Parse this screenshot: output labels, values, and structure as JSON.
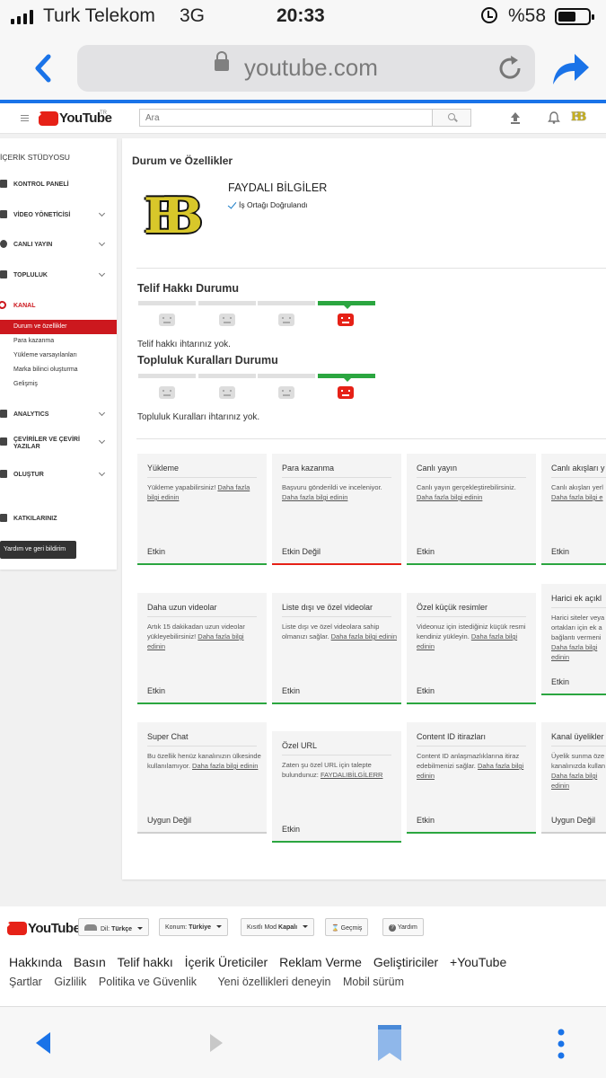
{
  "status_bar": {
    "carrier": "Turk Telekom",
    "network": "3G",
    "time": "20:33",
    "battery_percent": "%58",
    "battery_level": 0.58
  },
  "browser": {
    "url": "youtube.com"
  },
  "youtube_header": {
    "logo_text": "YouTube",
    "region_code": "TR",
    "search_placeholder": "Ara",
    "brand_color": "#e62117"
  },
  "sidebar": {
    "title": "İÇERİK STÜDYOSU",
    "items": [
      {
        "label": "KONTROL PANELİ",
        "icon": "dashboard-icon"
      },
      {
        "label": "VİDEO YÖNETİCİSİ",
        "icon": "video-manager-icon"
      },
      {
        "label": "CANLI YAYIN",
        "icon": "live-icon"
      },
      {
        "label": "TOPLULUK",
        "icon": "community-icon"
      },
      {
        "label": "KANAL",
        "icon": "channel-icon"
      },
      {
        "label": "ANALYTICS",
        "icon": "analytics-icon"
      },
      {
        "label": "ÇEVİRİLER VE ÇEVİRİ YAZILAR",
        "icon": "translate-icon"
      },
      {
        "label": "OLUŞTUR",
        "icon": "create-icon"
      },
      {
        "label": "KATKILARINIZ",
        "icon": "contributions-icon"
      }
    ],
    "kanal_sub": [
      "Durum ve özellikler",
      "Para kazanma",
      "Yükleme varsayılanları",
      "Marka bilinci oluşturma",
      "Gelişmiş"
    ],
    "help_button": "Yardım ve geri bildirim"
  },
  "main": {
    "title": "Durum ve Özellikler",
    "channel_name": "FAYDALI BİLGİLER",
    "partner_status": "İş Ortağı Doğrulandı",
    "copyright": {
      "title": "Telif Hakkı Durumu",
      "status": "Telif hakkı ihtarınız yok.",
      "active_segment": 4
    },
    "community": {
      "title": "Topluluk Kuralları Durumu",
      "status": "Topluluk Kuralları ihtarınız yok.",
      "active_segment": 4
    },
    "features": [
      {
        "title": "Yükleme",
        "desc": "Yükleme yapabilirsiniz!",
        "link": "Daha fazla bilgi edinin",
        "status": "Etkin",
        "state": "on"
      },
      {
        "title": "Para kazanma",
        "desc": "Başvuru gönderildi ve inceleniyor.",
        "link": "Daha fazla bilgi edinin",
        "status": "Etkin Değil",
        "state": "off"
      },
      {
        "title": "Canlı yayın",
        "desc": "Canlı yayın gerçekleştirebilirsiniz.",
        "link": "Daha fazla bilgi edinin",
        "status": "Etkin",
        "state": "on"
      },
      {
        "title": "Canlı akışları y",
        "desc": "Canlı akışları yerl",
        "link": "Daha fazla bilgi e",
        "status": "Etkin",
        "state": "on"
      },
      {
        "title": "Daha uzun videolar",
        "desc": "Artık 15 dakikadan uzun videolar yükleyebilirsiniz!",
        "link": "Daha fazla bilgi edinin",
        "status": "Etkin",
        "state": "on"
      },
      {
        "title": "Liste dışı ve özel videolar",
        "desc": "Liste dışı ve özel videolara sahip olmanızı sağlar.",
        "link": "Daha fazla bilgi edinin",
        "status": "Etkin",
        "state": "on"
      },
      {
        "title": "Özel küçük resimler",
        "desc": "Videonuz için istediğiniz küçük resmi kendiniz yükleyin.",
        "link": "Daha fazla bilgi edinin",
        "status": "Etkin",
        "state": "on"
      },
      {
        "title": "Harici ek açıkl",
        "desc": "Harici siteler veya ortakları için ek a bağlantı vermeni",
        "link": "Daha fazla bilgi edinin",
        "status": "Etkin",
        "state": "on"
      },
      {
        "title": "Super Chat",
        "desc": "Bu özellik henüz kanalınızın ülkesinde kullanılamıyor.",
        "link": "Daha fazla bilgi edinin",
        "status": "Uygun Değil",
        "state": "na"
      },
      {
        "title": "Özel URL",
        "desc": "Zaten şu özel URL için talepte bulundunuz:",
        "link": "FAYDALIBİLGİLERR",
        "status": "Etkin",
        "state": "on"
      },
      {
        "title": "Content ID itirazları",
        "desc": "Content ID anlaşmazlıklarına itiraz edebilmenizi sağlar.",
        "link": "Daha fazla bilgi edinin",
        "status": "Etkin",
        "state": "on"
      },
      {
        "title": "Kanal üyelikler",
        "desc": "Üyelik sunma öze kanalınızda kullan",
        "link": "Daha fazla bilgi edinin",
        "status": "Uygun Değil",
        "state": "na"
      }
    ]
  },
  "footer": {
    "logo_text": "YouTube",
    "language_label": "Dil:",
    "language_value": "Türkçe",
    "location_label": "Konum:",
    "location_value": "Türkiye",
    "restricted_label": "Kısıtlı Mod",
    "restricted_value": "Kapalı",
    "history": "Geçmiş",
    "help": "Yardım",
    "links_primary": [
      "Hakkında",
      "Basın",
      "Telif hakkı",
      "İçerik Üreticiler",
      "Reklam Verme",
      "Geliştiriciler",
      "+YouTube"
    ],
    "links_secondary": [
      "Şartlar",
      "Gizlilik",
      "Politika ve Güvenlik",
      "Yeni özellikleri deneyin",
      "Mobil sürüm"
    ]
  }
}
